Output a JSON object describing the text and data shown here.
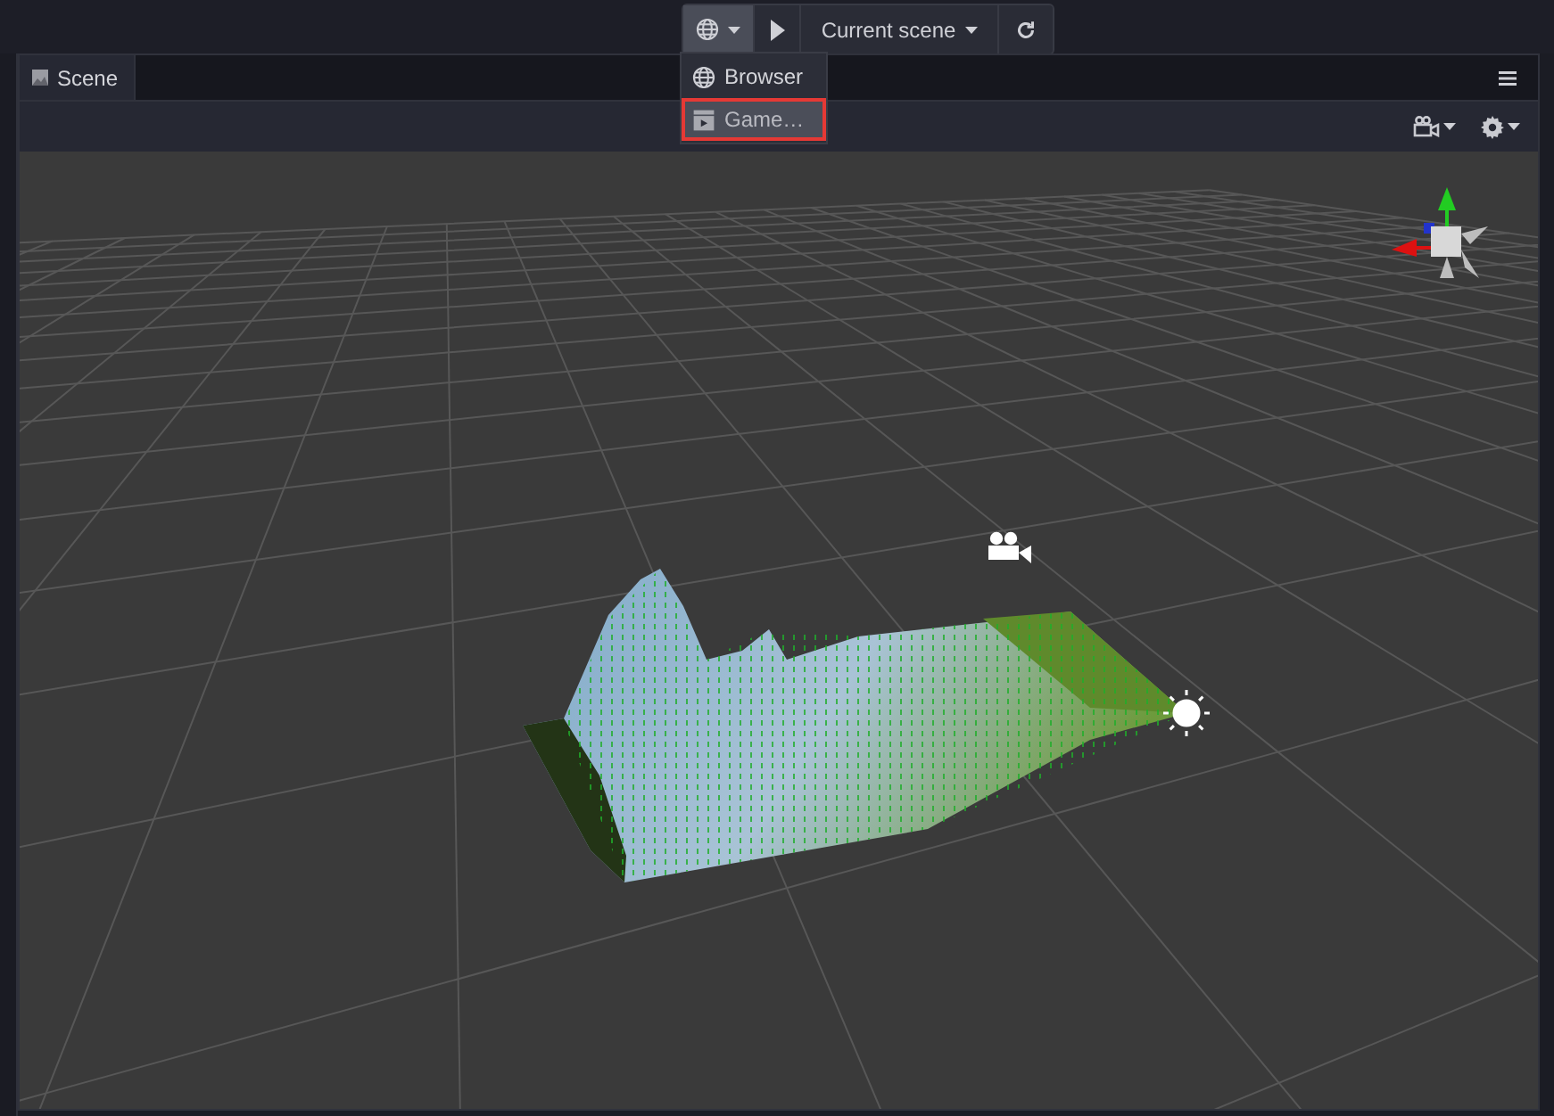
{
  "toolbar": {
    "scene_label": "Current scene"
  },
  "preview_menu": {
    "items": [
      {
        "kind": "browser",
        "label": "Browser",
        "selected": false
      },
      {
        "kind": "game",
        "label": "Game…",
        "selected": true
      }
    ]
  },
  "tabs": [
    {
      "label": "Scene",
      "selected": true
    }
  ]
}
